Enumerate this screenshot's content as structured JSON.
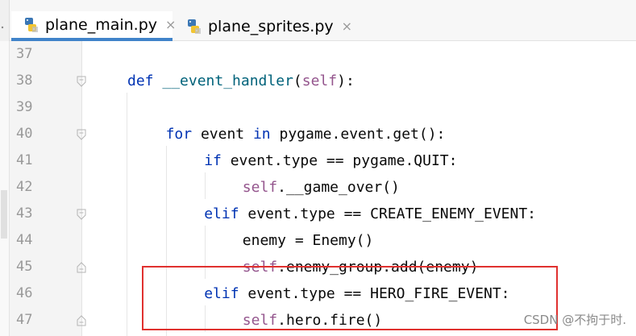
{
  "tabs": [
    {
      "label": "plane_main.py",
      "active": true,
      "icon": "python-file-icon"
    },
    {
      "label": "plane_sprites.py",
      "active": false,
      "icon": "python-file-icon"
    }
  ],
  "tab_close_glyph": "×",
  "editor": {
    "lines": [
      {
        "num": "37",
        "indent": "",
        "tokens": []
      },
      {
        "num": "38",
        "indent": "    ",
        "tokens": [
          [
            "kw",
            "def"
          ],
          [
            "fn",
            " __event_handler"
          ],
          [
            "p",
            "("
          ],
          [
            "self",
            "self"
          ],
          [
            "p",
            "):"
          ]
        ]
      },
      {
        "num": "39",
        "indent": "",
        "tokens": []
      },
      {
        "num": "40",
        "indent": "        ",
        "tokens": [
          [
            "kw",
            "for"
          ],
          [
            "p",
            " event "
          ],
          [
            "kw",
            "in"
          ],
          [
            "p",
            " pygame.event.get():"
          ]
        ]
      },
      {
        "num": "41",
        "indent": "            ",
        "tokens": [
          [
            "kw",
            "if"
          ],
          [
            "p",
            " event.type == pygame.QUIT:"
          ]
        ]
      },
      {
        "num": "42",
        "indent": "                ",
        "tokens": [
          [
            "self",
            "self"
          ],
          [
            "p",
            ".__game_over()"
          ]
        ]
      },
      {
        "num": "43",
        "indent": "            ",
        "tokens": [
          [
            "kw",
            "elif"
          ],
          [
            "p",
            " event.type == CREATE_ENEMY_EVENT:"
          ]
        ]
      },
      {
        "num": "44",
        "indent": "                ",
        "tokens": [
          [
            "p",
            "enemy = Enemy()"
          ]
        ]
      },
      {
        "num": "45",
        "indent": "                ",
        "tokens": [
          [
            "self",
            "self"
          ],
          [
            "p",
            ".enemy_group.add(enemy)"
          ]
        ]
      },
      {
        "num": "46",
        "indent": "            ",
        "tokens": [
          [
            "kw",
            "elif"
          ],
          [
            "p",
            " event.type == HERO_FIRE_EVENT:"
          ]
        ]
      },
      {
        "num": "47",
        "indent": "                ",
        "tokens": [
          [
            "self",
            "self"
          ],
          [
            "p",
            ".hero.fire()"
          ]
        ]
      }
    ]
  },
  "watermark": "CSDN @不拘于时.",
  "colors": {
    "keyword": "#0033b3",
    "self": "#94558d",
    "function": "#00627a",
    "highlight_border": "#e0312f",
    "tab_underline": "#4083c9"
  }
}
